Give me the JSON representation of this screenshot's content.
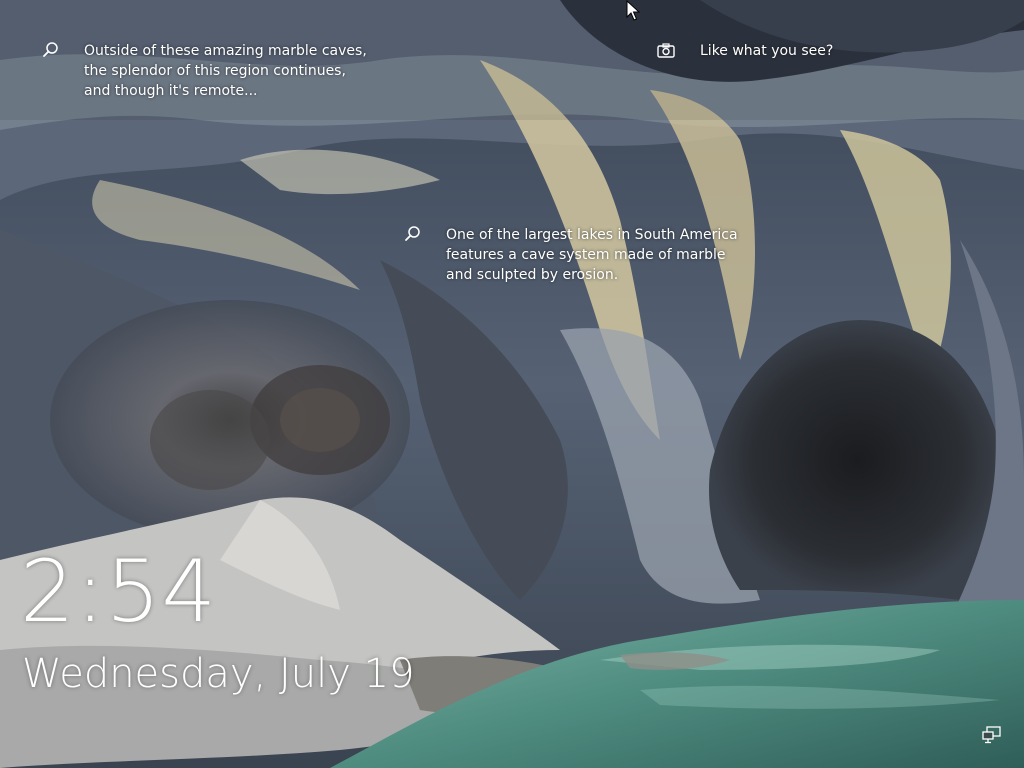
{
  "spotlight": {
    "hotspot_1": {
      "text": "Outside of these amazing marble caves,\nthe splendor of this region continues,\nand though it's remote...",
      "icon": "search-icon"
    },
    "like_prompt": {
      "text": "Like what you see?",
      "icon": "camera-icon"
    },
    "hotspot_2": {
      "text": "One of the largest lakes in South America\nfeatures a cave system made of marble\nand sculpted by erosion.",
      "icon": "search-icon"
    }
  },
  "lock": {
    "time": "2:54",
    "date": "Wednesday, July 19"
  },
  "status": {
    "network_icon": "network-wired-icon"
  },
  "colors": {
    "text": "#ffffff",
    "marble_gray": "#6c7686",
    "marble_cream": "#d6cfae",
    "water": "#5f9a8c"
  }
}
